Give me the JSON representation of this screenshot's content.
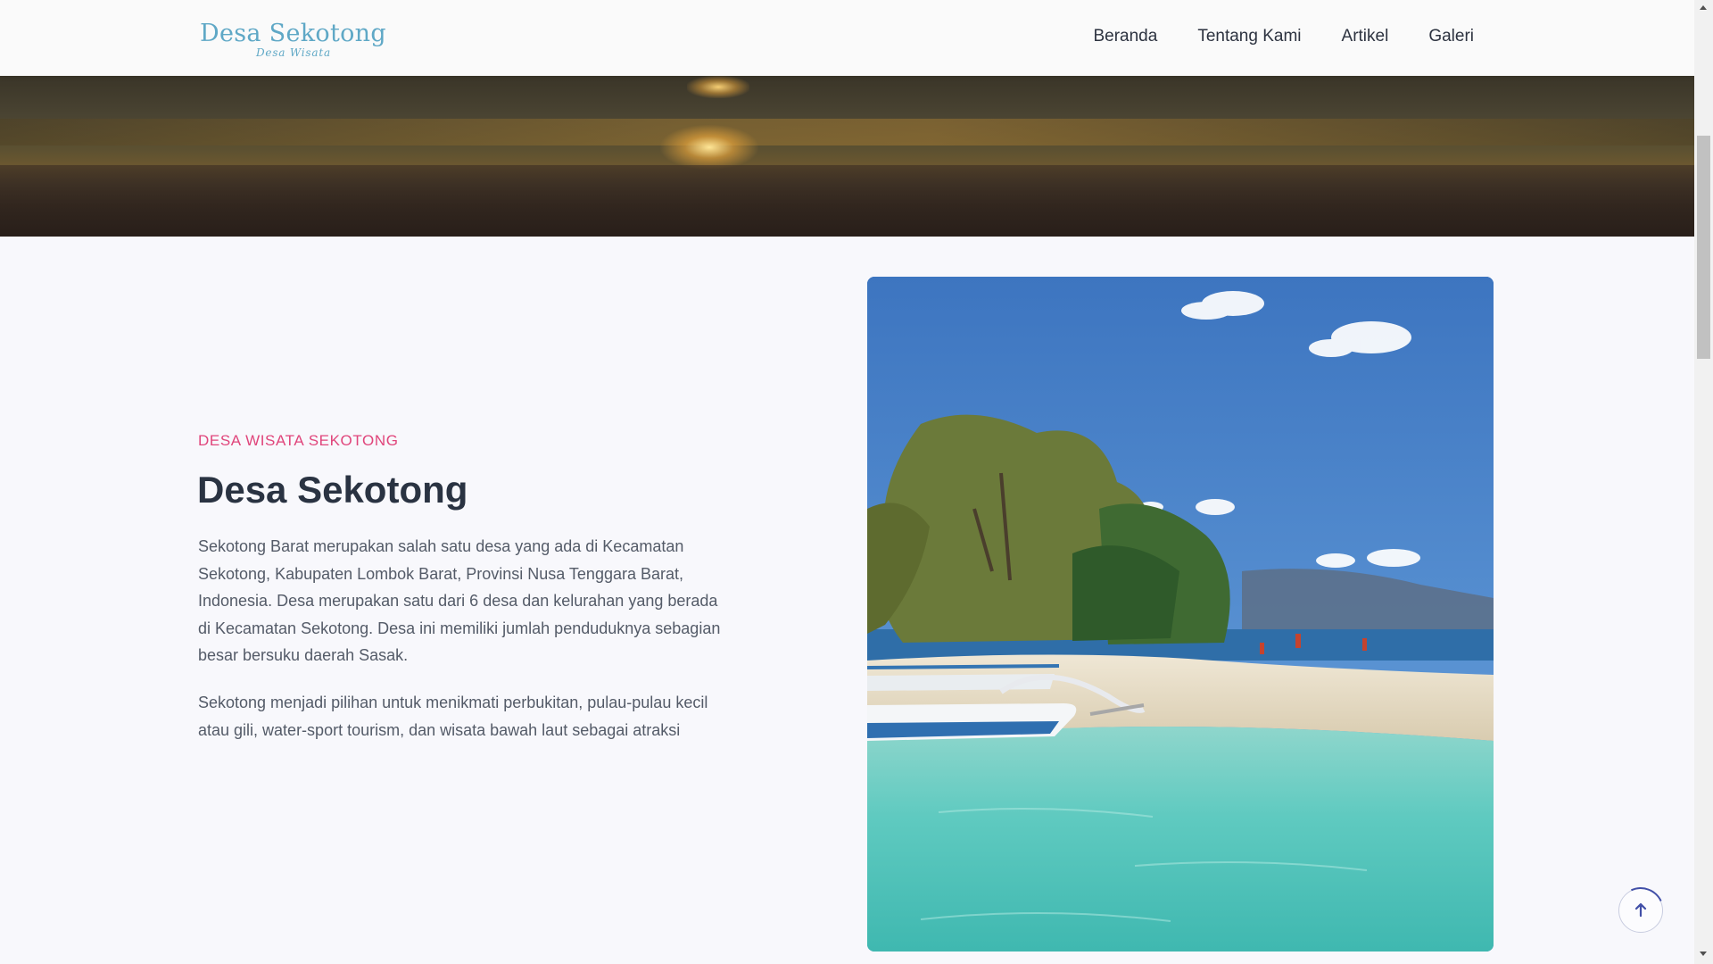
{
  "brand": {
    "title": "Desa Sekotong",
    "subtitle": "Desa Wisata",
    "color": "#5fa8c6"
  },
  "nav": {
    "items": [
      {
        "label": "Beranda"
      },
      {
        "label": "Tentang Kami"
      },
      {
        "label": "Artikel"
      },
      {
        "label": "Galeri"
      }
    ]
  },
  "hero": {
    "image": "sunset-beach-photo"
  },
  "about": {
    "eyebrow": "DESA WISATA SEKOTONG",
    "heading": "Desa Sekotong",
    "paragraph1": "Sekotong Barat merupakan salah satu desa yang ada di Kecamatan Sekotong, Kabupaten Lombok Barat,  Provinsi Nusa Tenggara Barat, Indonesia. Desa merupakan satu dari 6 desa dan kelurahan yang berada di  Kecamatan Sekotong. Desa ini memiliki jumlah penduduknya sebagian besar bersuku daerah Sasak.",
    "paragraph2": "Sekotong menjadi pilihan untuk menikmati  perbukitan, pulau-pulau kecil atau gili,  water-sport tourism, dan wisata bawah laut sebagai atraksi",
    "image": "island-beach-boat-photo",
    "accent_color": "#e0457b"
  },
  "scroll_top": {
    "icon": "arrow-up-icon",
    "accent_color": "#4250a8"
  }
}
